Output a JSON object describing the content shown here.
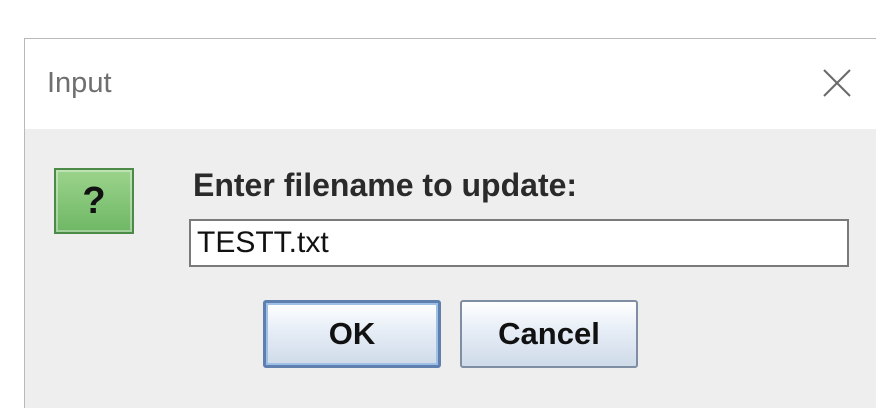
{
  "dialog": {
    "title": "Input",
    "prompt": "Enter filename to update:",
    "input_value": "TESTT.txt",
    "icon": "question-icon",
    "icon_glyph": "?",
    "buttons": {
      "ok_label": "OK",
      "cancel_label": "Cancel"
    },
    "colors": {
      "icon_green": "#7fc273",
      "button_border_focus": "#5f7fae"
    }
  }
}
